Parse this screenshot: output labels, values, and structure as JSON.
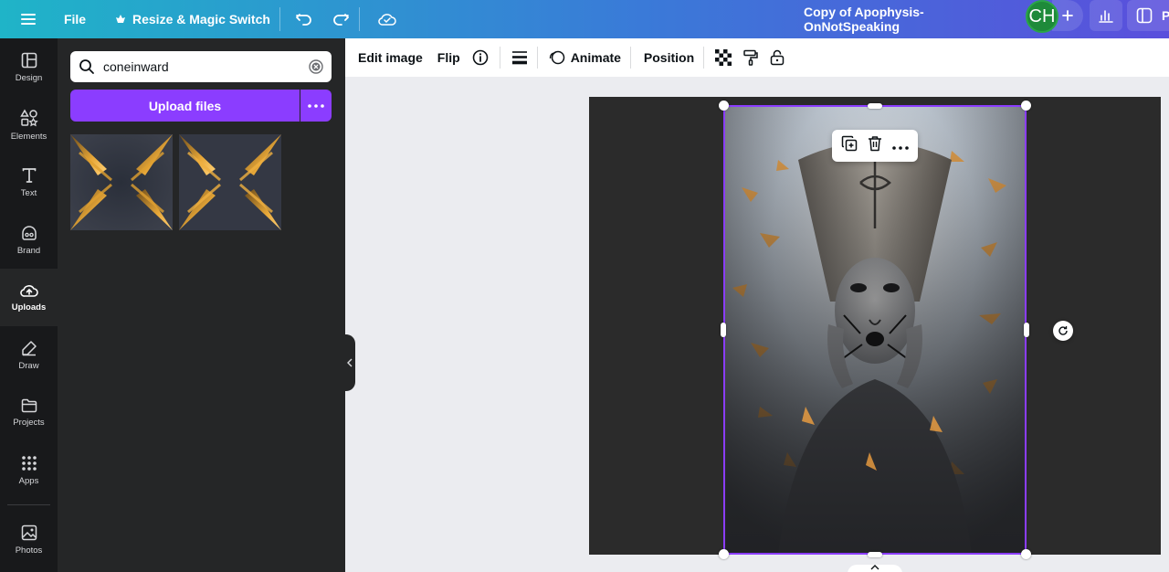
{
  "topbar": {
    "file_label": "File",
    "resize_label": "Resize & Magic Switch",
    "doc_title": "Copy of Apophysis-OnNotSpeaking",
    "avatar_initials": "CH",
    "present_label": "Pr"
  },
  "rail": {
    "items": [
      {
        "label": "Design",
        "icon": "design-icon"
      },
      {
        "label": "Elements",
        "icon": "elements-icon"
      },
      {
        "label": "Text",
        "icon": "text-icon"
      },
      {
        "label": "Brand",
        "icon": "brand-icon"
      },
      {
        "label": "Uploads",
        "icon": "upload-cloud-icon",
        "active": true
      },
      {
        "label": "Draw",
        "icon": "draw-icon"
      },
      {
        "label": "Projects",
        "icon": "folder-icon"
      },
      {
        "label": "Apps",
        "icon": "apps-grid-icon"
      },
      {
        "label": "Photos",
        "icon": "photo-icon"
      }
    ]
  },
  "panel": {
    "search_value": "coneinward",
    "upload_label": "Upload files"
  },
  "context_toolbar": {
    "edit_image_label": "Edit image",
    "flip_label": "Flip",
    "animate_label": "Animate",
    "position_label": "Position"
  },
  "colors": {
    "accent": "#8b3dff",
    "rail_bg": "#18191b",
    "panel_bg": "#252627",
    "canvas_bg": "#ebecf0",
    "page_bg": "#2b2b2b"
  }
}
